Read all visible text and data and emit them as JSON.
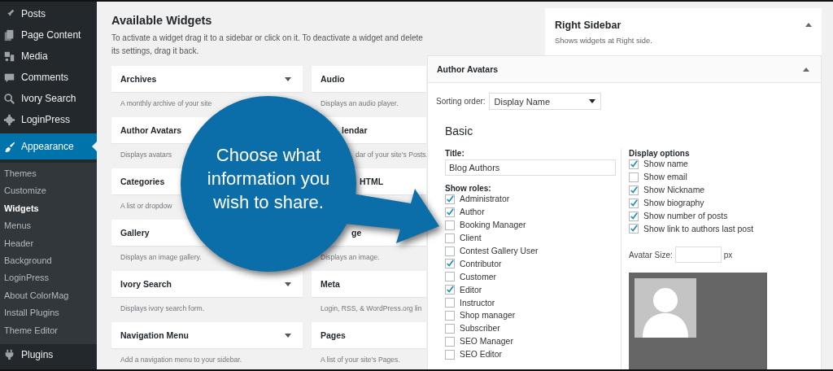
{
  "sidebar": {
    "items": [
      {
        "label": "Posts",
        "selected": false
      },
      {
        "label": "Page Content",
        "selected": false
      },
      {
        "label": "Media",
        "selected": false
      },
      {
        "label": "Comments",
        "selected": false
      },
      {
        "label": "Ivory Search",
        "selected": false
      },
      {
        "label": "LoginPress",
        "selected": false
      },
      {
        "label": "Appearance",
        "selected": true,
        "children": [
          {
            "label": "Themes",
            "selected": false
          },
          {
            "label": "Customize",
            "selected": false
          },
          {
            "label": "Widgets",
            "selected": true
          },
          {
            "label": "Menus",
            "selected": false
          },
          {
            "label": "Header",
            "selected": false
          },
          {
            "label": "Background",
            "selected": false
          },
          {
            "label": "LoginPress",
            "selected": false
          },
          {
            "label": "About ColorMag",
            "selected": false
          },
          {
            "label": "Install Plugins",
            "selected": false
          },
          {
            "label": "Theme Editor",
            "selected": false
          }
        ]
      },
      {
        "label": "Plugins",
        "selected": false
      }
    ]
  },
  "available_widgets": {
    "title": "Available Widgets",
    "description": "To activate a widget drag it to a sidebar or click on it. To deactivate a widget and delete its settings, drag it back.",
    "widgets": [
      {
        "name": "Archives",
        "description": "A monthly archive of your site",
        "caret": true
      },
      {
        "name": "Audio",
        "description": "Displays an audio player."
      },
      {
        "name": "Author Avatars",
        "description": "Displays avatars"
      },
      {
        "name": "lendar",
        "description": "dar of your site's Posts."
      },
      {
        "name": "Categories",
        "description": "A list or dropdow"
      },
      {
        "name": "HTML"
      },
      {
        "name": "Gallery",
        "description": "Displays an image gallery."
      },
      {
        "name": "ge",
        "description": "Displays an image."
      },
      {
        "name": "Ivory Search",
        "description": "Displays ivory search form.",
        "caret": true
      },
      {
        "name": "Meta",
        "description": "Login, RSS, & WordPress.org lin"
      },
      {
        "name": "Navigation Menu",
        "description": "Add a navigation menu to your sidebar.",
        "caret": true
      },
      {
        "name": "Pages",
        "description": "A list of your site's Pages."
      }
    ]
  },
  "right_sidebar": {
    "title": "Right Sidebar",
    "description": "Shows widgets at Right side."
  },
  "widget_panel": {
    "title": "Author Avatars",
    "sorting_label": "Sorting order:",
    "sorting_value": "Display Name",
    "section": "Basic",
    "title_label": "Title:",
    "title_value": "Blog Authors",
    "roles_label": "Show roles:",
    "roles": [
      {
        "label": "Administrator",
        "checked": true
      },
      {
        "label": "Author",
        "checked": true
      },
      {
        "label": "Booking Manager",
        "checked": false
      },
      {
        "label": "Client",
        "checked": false
      },
      {
        "label": "Contest Gallery User",
        "checked": false
      },
      {
        "label": "Contributor",
        "checked": true
      },
      {
        "label": "Customer",
        "checked": false
      },
      {
        "label": "Editor",
        "checked": true
      },
      {
        "label": "Instructor",
        "checked": false
      },
      {
        "label": "Shop manager",
        "checked": false
      },
      {
        "label": "Subscriber",
        "checked": false
      },
      {
        "label": "SEO Manager",
        "checked": false
      },
      {
        "label": "SEO Editor",
        "checked": false
      }
    ],
    "display_label": "Display options",
    "display_options": [
      {
        "label": "Show name",
        "checked": true
      },
      {
        "label": "Show email",
        "checked": false
      },
      {
        "label": "Show Nickname",
        "checked": true
      },
      {
        "label": "Show biography",
        "checked": true
      },
      {
        "label": "Show number of posts",
        "checked": true
      },
      {
        "label": "Show link to authors last post",
        "checked": true
      }
    ],
    "avatar_size_label": "Avatar Size:",
    "avatar_size_unit": "px"
  },
  "callout": {
    "text": "Choose what information you wish to share."
  }
}
